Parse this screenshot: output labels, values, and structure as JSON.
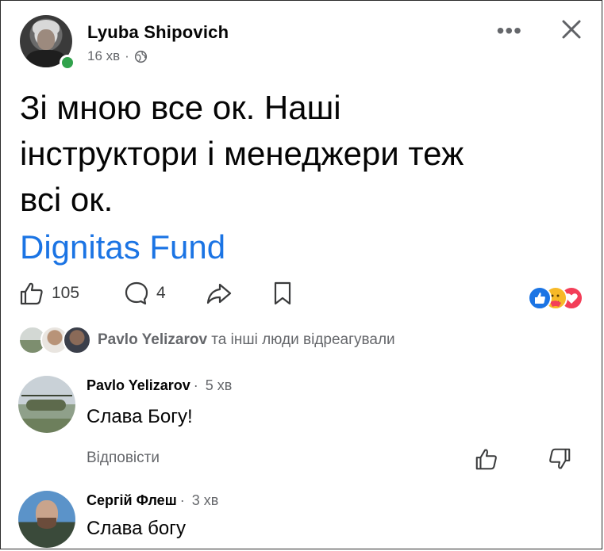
{
  "post": {
    "author": "Lyuba Shipovich",
    "time": "16 хв",
    "separator": "·",
    "text_lines": [
      "Зі мною все ок. Наші",
      "інструктори і менеджери теж",
      "всі ок."
    ],
    "link_text": "Dignitas Fund",
    "accent_color": "#1b74e4",
    "online_color": "#31a24c"
  },
  "actions": {
    "like_count": "105",
    "comment_count": "4"
  },
  "reactions": {
    "types": [
      "like",
      "care",
      "love"
    ],
    "reacted_name": "Pavlo Yelizarov",
    "reacted_suffix": "та інші люди відреагували"
  },
  "comments": [
    {
      "name": "Pavlo Yelizarov",
      "time": "5 хв",
      "text": "Слава Богу!",
      "reply_label": "Відповісти"
    },
    {
      "name": "Сергій Флеш",
      "time": "3 хв",
      "text": "Слава богу"
    }
  ],
  "icons": [
    "globe-icon",
    "more-icon",
    "close-icon",
    "like-icon",
    "comment-icon",
    "share-icon",
    "save-icon",
    "thumb-up-icon",
    "thumb-down-icon"
  ]
}
